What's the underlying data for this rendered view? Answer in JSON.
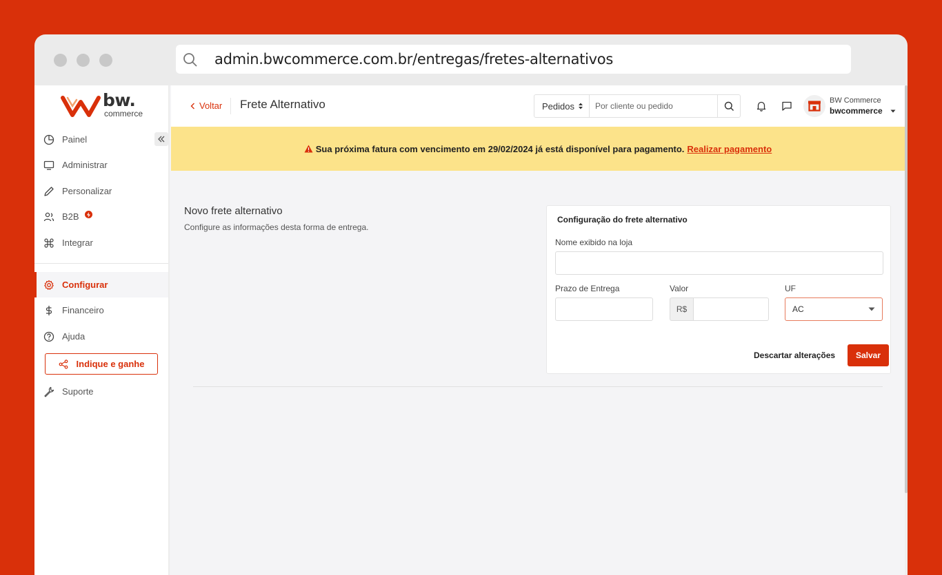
{
  "browser": {
    "url": "admin.bwcommerce.com.br/entregas/fretes-alternativos"
  },
  "logo": {
    "brand": "bw.",
    "sub": "commerce"
  },
  "sidebar": {
    "items": [
      {
        "label": "Painel"
      },
      {
        "label": "Administrar"
      },
      {
        "label": "Personalizar"
      },
      {
        "label": "B2B"
      },
      {
        "label": "Integrar"
      },
      {
        "label": "Configurar",
        "active": true
      },
      {
        "label": "Financeiro"
      },
      {
        "label": "Ajuda"
      },
      {
        "label": "Suporte"
      }
    ],
    "refer_button": "Indique e ganhe"
  },
  "topbar": {
    "back_label": "Voltar",
    "title": "Frete Alternativo",
    "search_scope": "Pedidos",
    "search_placeholder": "Por cliente ou pedido",
    "account_name": "BW Commerce",
    "account_user": "bwcommerce"
  },
  "alert": {
    "text": "Sua próxima fatura com vencimento em 29/02/2024 já está disponível para pagamento.",
    "link": "Realizar pagamento"
  },
  "section": {
    "title": "Novo frete alternativo",
    "description": "Configure as informações desta forma de entrega."
  },
  "form": {
    "card_title": "Configuração do frete alternativo",
    "name_label": "Nome exibido na loja",
    "name_value": "",
    "prazo_label": "Prazo de Entrega",
    "prazo_value": "",
    "valor_label": "Valor",
    "currency": "R$",
    "valor_value": "",
    "uf_label": "UF",
    "uf_value": "AC",
    "discard_label": "Descartar alterações",
    "save_label": "Salvar"
  },
  "colors": {
    "accent": "#d9300a",
    "alert_bg": "#fce38a"
  }
}
